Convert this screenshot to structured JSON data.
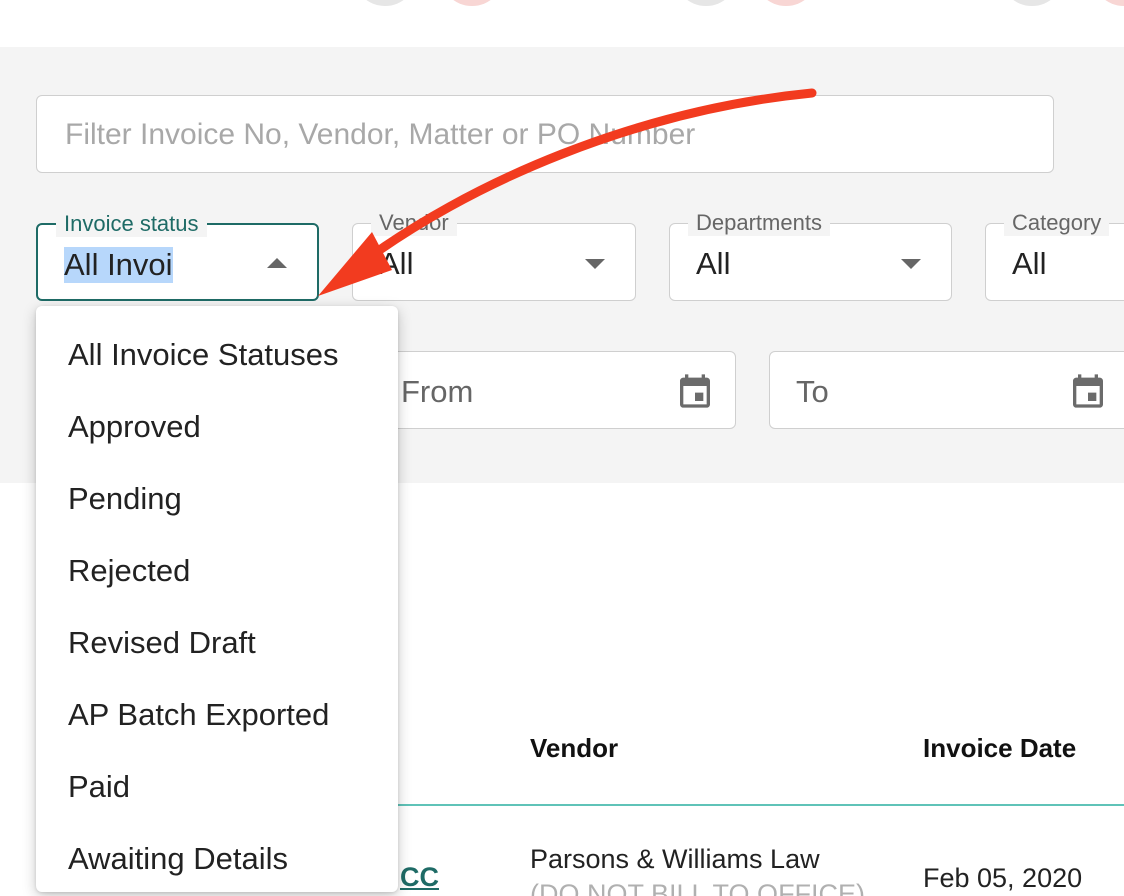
{
  "search": {
    "placeholder": "Filter Invoice No, Vendor, Matter or PO Number"
  },
  "filters": {
    "invoice_status": {
      "label": "Invoice status",
      "value": "All Invoi"
    },
    "vendor": {
      "label": "Vendor",
      "value": "All"
    },
    "departments": {
      "label": "Departments",
      "value": "All"
    },
    "category": {
      "label": "Category",
      "value": "All"
    }
  },
  "dates": {
    "from": "From",
    "to": "To"
  },
  "dropdown": {
    "items": [
      "All Invoice Statuses",
      "Approved",
      "Pending",
      "Rejected",
      "Revised Draft",
      "AP Batch Exported",
      "Paid",
      "Awaiting Details"
    ]
  },
  "table": {
    "headers": {
      "vendor": "Vendor",
      "invoice_date": "Invoice Date"
    },
    "row": {
      "link_fragment": "CC",
      "vendor": "Parsons & Williams Law",
      "vendor_sub": "(DO NOT BILL TO OFFICE)",
      "invoice_date": "Feb 05, 2020"
    }
  },
  "colors": {
    "accent": "#1e6b66",
    "annotation_arrow": "#f23b1f",
    "selection_highlight": "#b7d7fb",
    "table_divider": "#5fc3b8"
  },
  "icons": {
    "calendar": "calendar-icon",
    "caret_up": "caret-up-icon",
    "caret_down": "caret-down-icon"
  }
}
